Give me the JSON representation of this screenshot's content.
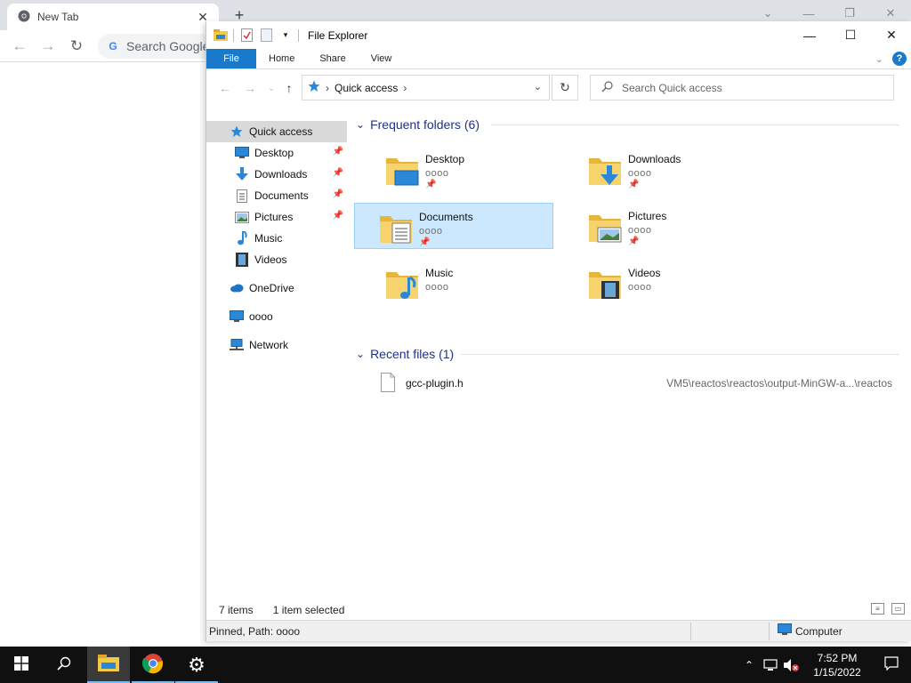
{
  "chrome": {
    "tab_title": "New Tab",
    "tab_close": "✕",
    "new_tab": "+",
    "omnibox_placeholder": "Search Google or type a URL",
    "omnibox_text": "Search Google"
  },
  "explorer": {
    "title": "File Explorer",
    "ribbon_tabs": [
      "File",
      "Home",
      "Share",
      "View"
    ],
    "help": "?",
    "address": {
      "crumb": "Quick access"
    },
    "search_placeholder": "Search Quick access",
    "nav": {
      "quick_access": "Quick access",
      "pinned": [
        {
          "label": "Desktop",
          "icon": "desktop-icon",
          "pinned": true
        },
        {
          "label": "Downloads",
          "icon": "downloads-icon",
          "pinned": true
        },
        {
          "label": "Documents",
          "icon": "documents-icon",
          "pinned": true
        },
        {
          "label": "Pictures",
          "icon": "pictures-icon",
          "pinned": true
        },
        {
          "label": "Music",
          "icon": "music-icon",
          "pinned": false
        },
        {
          "label": "Videos",
          "icon": "videos-icon",
          "pinned": false
        }
      ],
      "onedrive": "OneDrive",
      "this_pc": "oooo",
      "network": "Network"
    },
    "frequent": {
      "header": "Frequent folders (6)",
      "folders": [
        {
          "name": "Desktop",
          "location": "oooo",
          "pinned": true,
          "selected": false
        },
        {
          "name": "Downloads",
          "location": "oooo",
          "pinned": true,
          "selected": false
        },
        {
          "name": "Documents",
          "location": "oooo",
          "pinned": true,
          "selected": true
        },
        {
          "name": "Pictures",
          "location": "oooo",
          "pinned": true,
          "selected": false
        },
        {
          "name": "Music",
          "location": "oooo",
          "pinned": false,
          "selected": false
        },
        {
          "name": "Videos",
          "location": "oooo",
          "pinned": false,
          "selected": false
        }
      ]
    },
    "recent": {
      "header": "Recent files (1)",
      "files": [
        {
          "name": "gcc-plugin.h",
          "path": "VM5\\reactos\\reactos\\output-MinGW-a...\\reactos"
        }
      ]
    },
    "status": {
      "item_count": "7 items",
      "selection": "1 item selected"
    },
    "infobar": {
      "left": "Pinned, Path: oooo",
      "right": "Computer"
    }
  },
  "taskbar": {
    "time": "7:52 PM",
    "date": "1/15/2022"
  },
  "colors": {
    "accent": "#1979ca",
    "selection": "#cce8ff",
    "folder": "#f3c94a",
    "header_blue": "#1e3287",
    "taskbar": "#101010"
  }
}
